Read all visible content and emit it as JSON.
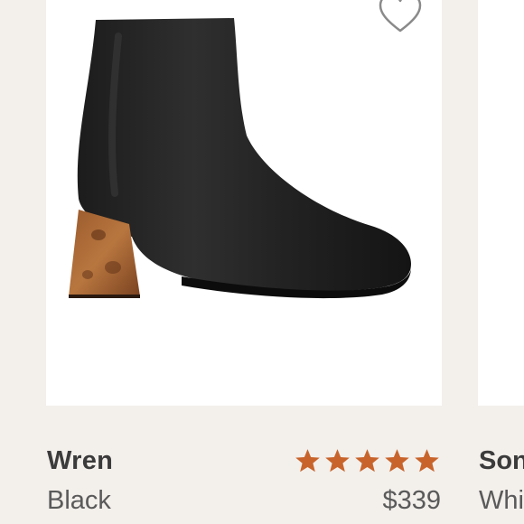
{
  "product": {
    "name": "Wren",
    "color": "Black",
    "price": "$339",
    "rating": 5,
    "rating_max": 5,
    "star_color": "#c8642b",
    "image": "black-ankle-boot-wood-heel"
  },
  "next_product": {
    "name": "Son",
    "color": "Whi"
  },
  "icons": {
    "wishlist": "heart-outline-icon"
  }
}
